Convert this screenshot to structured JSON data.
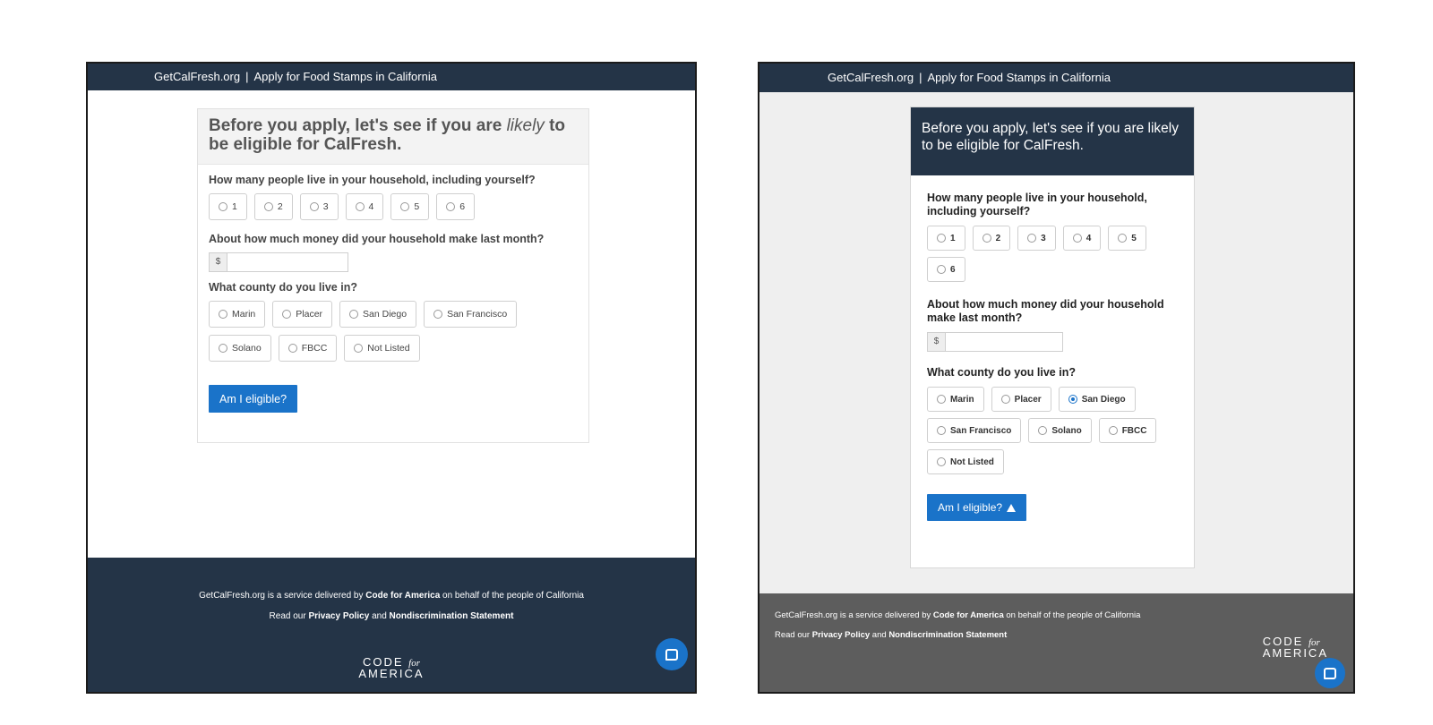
{
  "header": {
    "site": "GetCalFresh.org",
    "separator": "|",
    "tagline": "Apply for Food Stamps in California"
  },
  "variant_a": {
    "title_before": "Before you apply, let's see if you are ",
    "title_emphasis": "likely",
    "title_after": " to be eligible for CalFresh.",
    "household_question": "How many people live in your household, including yourself?",
    "household_options": [
      "1",
      "2",
      "3",
      "4",
      "5",
      "6"
    ],
    "income_question": "About how much money did your household make last month?",
    "currency_addon": "$",
    "income_value": "",
    "county_question": "What county do you live in?",
    "county_options": [
      "Marin",
      "Placer",
      "San Diego",
      "San Francisco",
      "Solano",
      "FBCC",
      "Not Listed"
    ],
    "submit_label": "Am I eligible?",
    "footer": {
      "line1_prefix": "GetCalFresh.org is a service delivered by ",
      "line1_org": "Code for America",
      "line1_suffix": " on behalf of the people of California",
      "line2_prefix": "Read our ",
      "privacy_label": "Privacy Policy",
      "line2_and": " and ",
      "nondiscrimination_label": "Nondiscrimination Statement"
    }
  },
  "variant_b": {
    "title": "Before you apply, let's see if you are likely to be eligible for CalFresh.",
    "household_question": "How many people live in your household, including yourself?",
    "household_options": [
      "1",
      "2",
      "3",
      "4",
      "5",
      "6"
    ],
    "income_question": "About how much money did your household make last month?",
    "currency_addon": "$",
    "income_value": "",
    "county_question": "What county do you live in?",
    "county_options": [
      "Marin",
      "Placer",
      "San Diego",
      "San Francisco",
      "Solano",
      "FBCC",
      "Not Listed"
    ],
    "selected_county": "San Diego",
    "submit_label": "Am I eligible?",
    "submit_icon": "warning-icon",
    "footer": {
      "line1_prefix": "GetCalFresh.org is a service delivered by ",
      "line1_org": "Code for America",
      "line1_suffix": " on behalf of the people of California",
      "line2_prefix": "Read our ",
      "privacy_label": "Privacy Policy",
      "line2_and": " and ",
      "nondiscrimination_label": "Nondiscrimination Statement"
    }
  },
  "logo": {
    "line1": "CODE",
    "for": "for",
    "line2": "AMERICA"
  },
  "icons": {
    "chat": "chat-icon",
    "radio": "radio-icon"
  },
  "colors": {
    "navy": "#243447",
    "primary_blue": "#1a73c9",
    "footer_gray": "#5d5d5d",
    "page_gray": "#efefef"
  }
}
